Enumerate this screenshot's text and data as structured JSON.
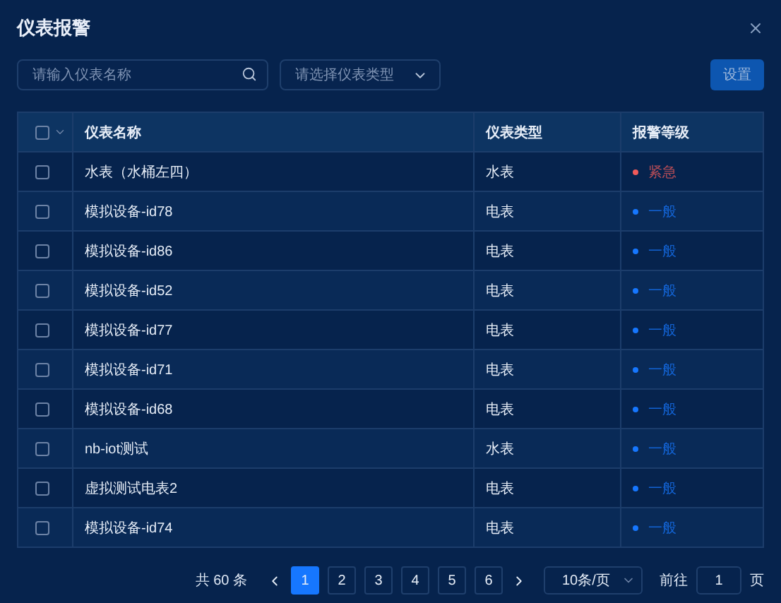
{
  "dialog": {
    "title": "仪表报警"
  },
  "toolbar": {
    "search_placeholder": "请输入仪表名称",
    "type_placeholder": "请选择仪表类型",
    "settings_button": "设置"
  },
  "table": {
    "header_checked": false,
    "columns": [
      "仪表名称",
      "仪表类型",
      "报警等级"
    ],
    "rows": [
      {
        "checked": false,
        "name": "水表（水桶左四）",
        "type": "水表",
        "level": "紧急",
        "color": "#f05a5a"
      },
      {
        "checked": false,
        "name": "模拟设备-id78",
        "type": "电表",
        "level": "一般",
        "color": "#1677ff"
      },
      {
        "checked": false,
        "name": "模拟设备-id86",
        "type": "电表",
        "level": "一般",
        "color": "#1677ff"
      },
      {
        "checked": false,
        "name": "模拟设备-id52",
        "type": "电表",
        "level": "一般",
        "color": "#1677ff"
      },
      {
        "checked": false,
        "name": "模拟设备-id77",
        "type": "电表",
        "level": "一般",
        "color": "#1677ff"
      },
      {
        "checked": false,
        "name": "模拟设备-id71",
        "type": "电表",
        "level": "一般",
        "color": "#1677ff"
      },
      {
        "checked": false,
        "name": "模拟设备-id68",
        "type": "电表",
        "level": "一般",
        "color": "#1677ff"
      },
      {
        "checked": false,
        "name": "nb-iot测试",
        "type": "水表",
        "level": "一般",
        "color": "#1677ff"
      },
      {
        "checked": false,
        "name": "虚拟测试电表2",
        "type": "电表",
        "level": "一般",
        "color": "#1677ff"
      },
      {
        "checked": false,
        "name": "模拟设备-id74",
        "type": "电表",
        "level": "一般",
        "color": "#1677ff"
      }
    ]
  },
  "pagination": {
    "total": "共 60 条",
    "pages": [
      {
        "label": "1",
        "selected": true
      },
      {
        "label": "2",
        "selected": false
      },
      {
        "label": "3",
        "selected": false
      },
      {
        "label": "4",
        "selected": false
      },
      {
        "label": "5",
        "selected": false
      },
      {
        "label": "6",
        "selected": false
      }
    ],
    "page_size": "10条/页",
    "goto_label": "前往",
    "goto_value": "1",
    "page_suffix": "页"
  }
}
